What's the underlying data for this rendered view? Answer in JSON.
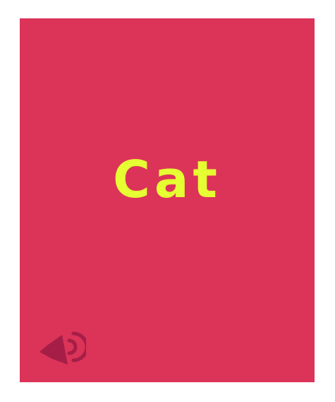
{
  "card": {
    "word": "Cat",
    "background_color": "#dc3359",
    "text_color": "#e6ff33",
    "audio_button": {
      "icon": "speaker-icon",
      "icon_color": "#a51e47"
    }
  }
}
